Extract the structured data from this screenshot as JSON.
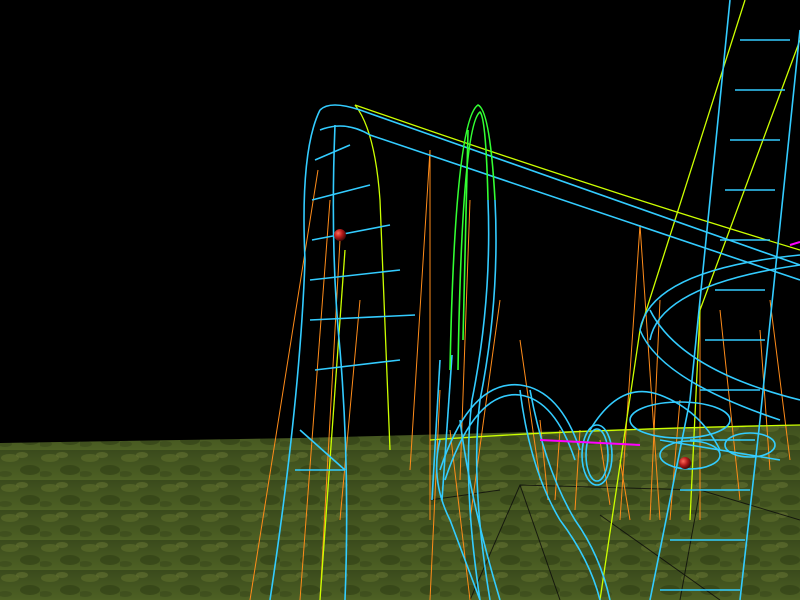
{
  "scene": {
    "kind": "3D wireframe roller coaster viewport",
    "colors": {
      "sky": "#000000",
      "ground_dark": "#2a3a14",
      "ground_light": "#5d6e2c",
      "track": "#33ccff",
      "track_alt": "#66e8ff",
      "green_track": "#33ff33",
      "guide_line": "#ccff00",
      "support": "#ff8c1a",
      "magenta_segment": "#ff00ff",
      "marker": "#b31a1a"
    },
    "markers": 2
  }
}
